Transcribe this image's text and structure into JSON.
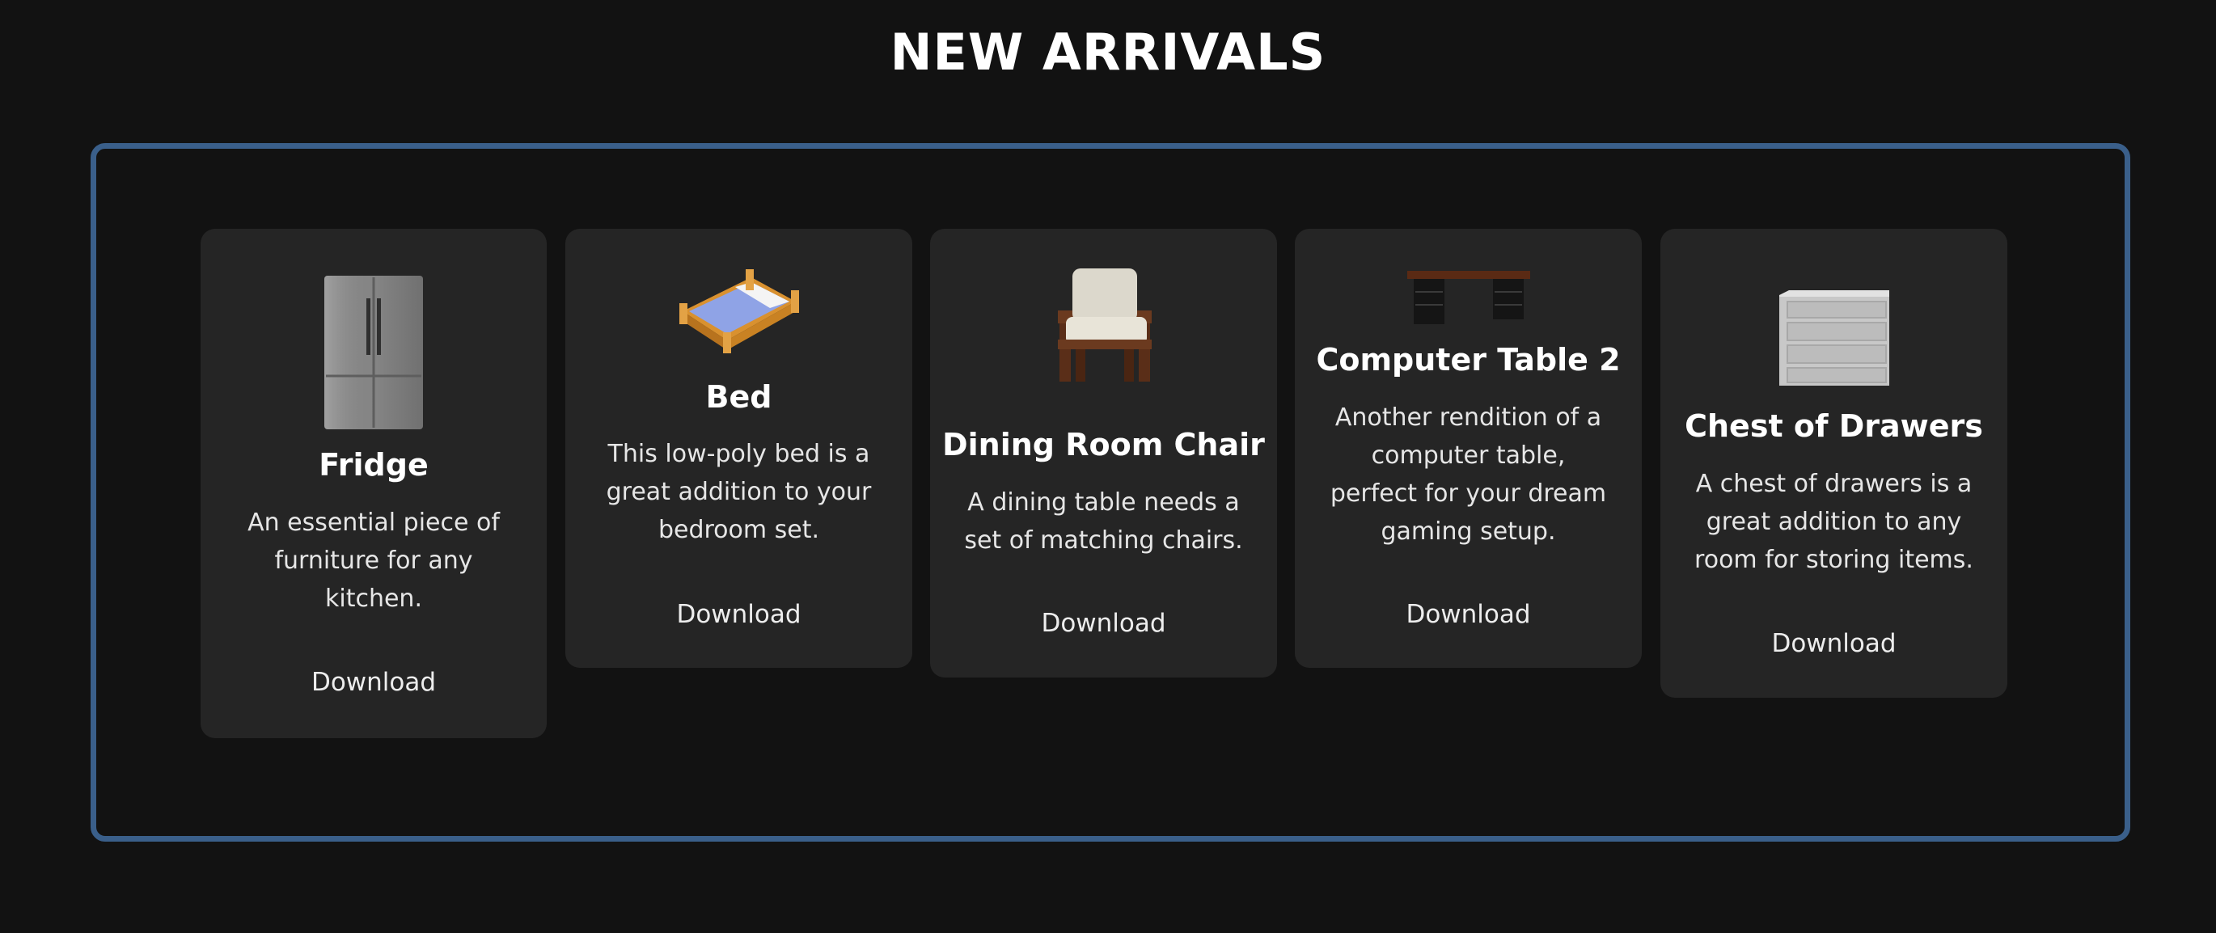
{
  "header": {
    "title": "NEW ARRIVALS"
  },
  "products": [
    {
      "name": "Fridge",
      "description": "An essential piece of furniture for any kitchen.",
      "action": "Download",
      "icon": "fridge-icon"
    },
    {
      "name": "Bed",
      "description": "This low-poly bed is a great addition to your bedroom set.",
      "action": "Download",
      "icon": "bed-icon"
    },
    {
      "name": "Dining Room Chair",
      "description": "A dining table needs a set of matching chairs.",
      "action": "Download",
      "icon": "chair-icon"
    },
    {
      "name": "Computer Table 2",
      "description": "Another rendition of a computer table, perfect for your dream gaming setup.",
      "action": "Download",
      "icon": "computer-table-icon"
    },
    {
      "name": "Chest of Drawers",
      "description": "A chest of drawers is a great addition to any room for storing items.",
      "action": "Download",
      "icon": "chest-of-drawers-icon"
    }
  ],
  "colors": {
    "background": "#121212",
    "card": "#252525",
    "frame_border": "#3a5f8a"
  }
}
